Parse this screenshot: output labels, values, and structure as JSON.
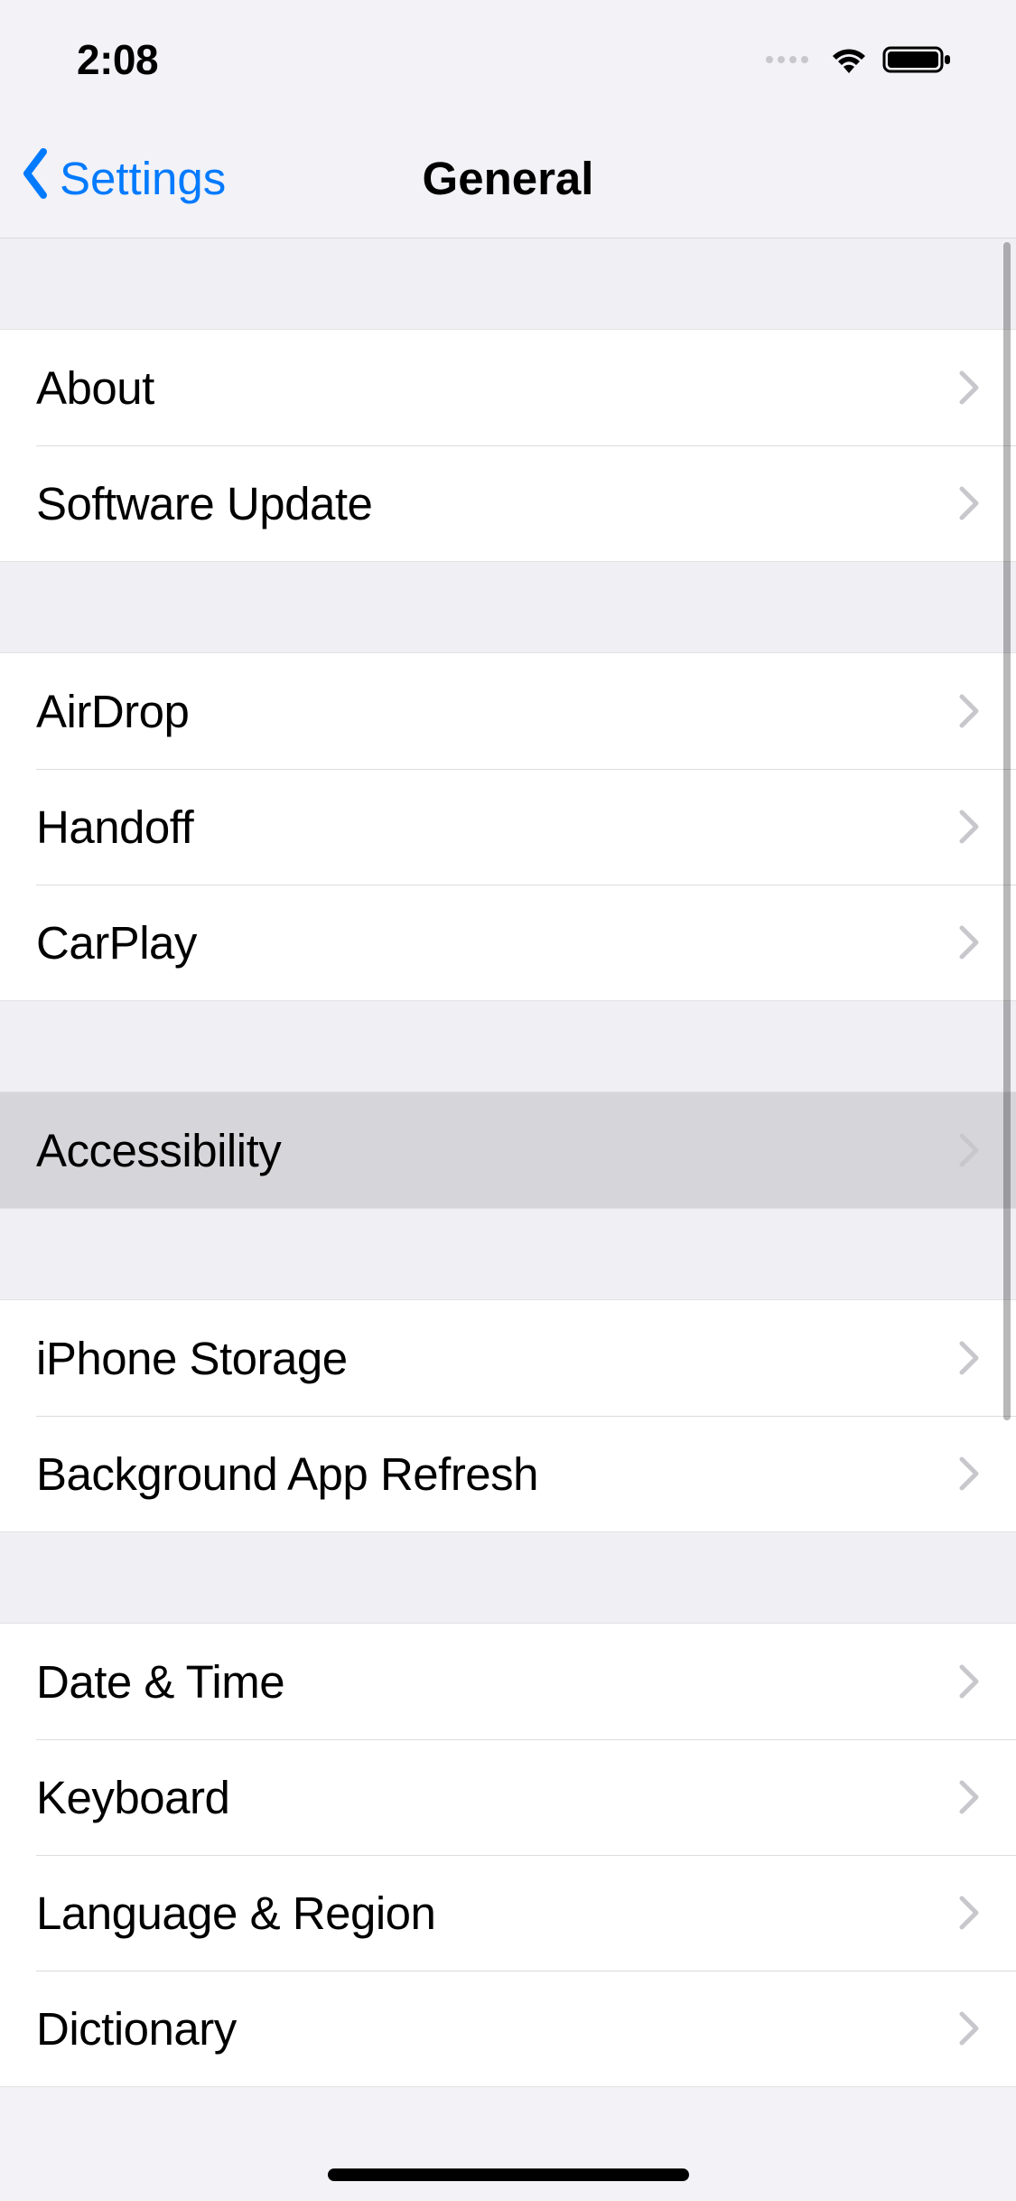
{
  "status": {
    "time": "2:08"
  },
  "nav": {
    "back_label": "Settings",
    "title": "General"
  },
  "sections": [
    {
      "rows": [
        {
          "id": "about",
          "label": "About",
          "highlighted": false
        },
        {
          "id": "software-update",
          "label": "Software Update",
          "highlighted": false
        }
      ]
    },
    {
      "rows": [
        {
          "id": "airdrop",
          "label": "AirDrop",
          "highlighted": false
        },
        {
          "id": "handoff",
          "label": "Handoff",
          "highlighted": false
        },
        {
          "id": "carplay",
          "label": "CarPlay",
          "highlighted": false
        }
      ]
    },
    {
      "rows": [
        {
          "id": "accessibility",
          "label": "Accessibility",
          "highlighted": true
        }
      ]
    },
    {
      "rows": [
        {
          "id": "iphone-storage",
          "label": "iPhone Storage",
          "highlighted": false
        },
        {
          "id": "background-app-refresh",
          "label": "Background App Refresh",
          "highlighted": false
        }
      ]
    },
    {
      "rows": [
        {
          "id": "date-time",
          "label": "Date & Time",
          "highlighted": false
        },
        {
          "id": "keyboard",
          "label": "Keyboard",
          "highlighted": false
        },
        {
          "id": "language-region",
          "label": "Language & Region",
          "highlighted": false
        },
        {
          "id": "dictionary",
          "label": "Dictionary",
          "highlighted": false
        }
      ]
    }
  ]
}
